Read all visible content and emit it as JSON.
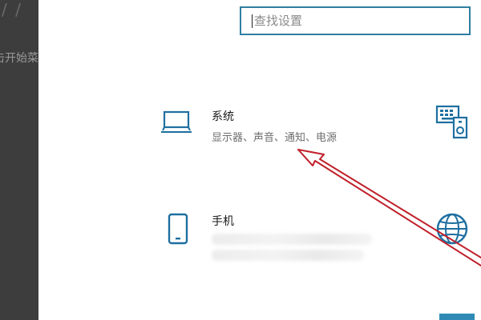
{
  "left_window": {
    "glyphs": "/ /",
    "partial_text": "击开始菜"
  },
  "search": {
    "placeholder": "查找设置",
    "value": ""
  },
  "tiles": [
    {
      "title": "系统",
      "description": "显示器、声音、通知、电源",
      "icon": "laptop-icon"
    },
    {
      "title": "手机",
      "description": "",
      "icon": "phone-icon"
    },
    {
      "title": "",
      "description": "",
      "icon": "devices-icon"
    },
    {
      "title": "",
      "description": "",
      "icon": "globe-icon"
    }
  ],
  "colors": {
    "accent": "#2f7ea1",
    "icon": "#1d6fa0",
    "annotation_arrow": "#c0202a",
    "sidebar": "#3d3d3d"
  }
}
